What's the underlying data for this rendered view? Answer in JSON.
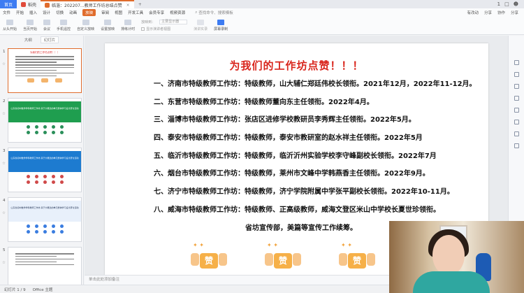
{
  "titlebar": {
    "tabs": [
      {
        "label": "首页",
        "kind": "home"
      },
      {
        "label": "稻壳",
        "kind": "doc"
      },
      {
        "label": "临淄：202207...教师工作坊总结点赞",
        "kind": "ppt"
      }
    ],
    "new_tab": "+",
    "right_items": [
      "1",
      "□",
      "☻"
    ]
  },
  "menubar": {
    "items": [
      "文件",
      "开始",
      "插入",
      "设计",
      "切换",
      "动画",
      "放映",
      "审阅",
      "视图",
      "开发工具",
      "会员专享",
      "视频资源"
    ],
    "active_index": 6,
    "search_placeholder": "查找命令、搜索模板",
    "right": [
      "有改动",
      "分享",
      "协作",
      "分享"
    ]
  },
  "ribbon": {
    "buttons": [
      {
        "label": "从头开始",
        "enabled": true
      },
      {
        "label": "当页开始",
        "enabled": true
      },
      {
        "label": "会议",
        "enabled": true
      },
      {
        "label": "手机遥控",
        "enabled": true
      },
      {
        "label": "自定义放映",
        "enabled": true
      },
      {
        "label": "设置放映",
        "enabled": true
      },
      {
        "label": "排练计时",
        "enabled": true
      }
    ],
    "group": {
      "row1_label": "放映到：",
      "row1_value": "主要显示器",
      "row2_label": "显示演讲者视图"
    },
    "buttons2": [
      {
        "label": "演讲实录",
        "enabled": false
      },
      {
        "label": "屏幕录制",
        "enabled": true
      }
    ]
  },
  "leftpanel": {
    "tabs": [
      "大纲",
      "幻灯片"
    ],
    "active_tab": 1,
    "slides": [
      {
        "num": "1",
        "style": "title",
        "caption": "为我们的工作坊点赞！！！"
      },
      {
        "num": "2",
        "style": "green",
        "caption": "山东省初中数学学科教师工作坊 基于大概念的单元整体学习设计研讨活动"
      },
      {
        "num": "3",
        "style": "blue",
        "caption": "山东省初中数学学科教师工作坊 基于大概念的单元整体学习设计研讨活动"
      },
      {
        "num": "4",
        "style": "light",
        "caption": "山东省初中数学学科教师工作坊 基于大概念的单元整体学习设计研讨活动"
      },
      {
        "num": "5",
        "style": "title",
        "caption": ""
      }
    ]
  },
  "slide": {
    "title": "为我们的工作坊点赞！！！",
    "items": [
      {
        "prefix": "一、济南市特级教师工作坊：特级教师，",
        "text": "山大辅仁郑廷伟校长领衔。2021年12月，2022年11-12月。"
      },
      {
        "prefix": "二、东营市特级教师工作坊：特级教师",
        "text": "董向东主任领衔。2022年4月。"
      },
      {
        "prefix": "三、淄博市特级教师工作坊：",
        "text": "张店区进修学校教研员李秀辉主任领衔。2022年5月。"
      },
      {
        "prefix": "四、泰安市特级教师工作坊：特级教师，",
        "text": "泰安市教研室的赵水祥主任领衔。2022年5月"
      },
      {
        "prefix": "五、临沂市特级教师工作坊：特级教师，",
        "text": "临沂沂州实验学校李守峰副校长领衔。2022年7月"
      },
      {
        "prefix": "六、烟台市特级教师工作坊：特级教师，",
        "text": "莱州市文峰中学韩燕香主任领衔。2022年9月。"
      },
      {
        "prefix": "七、济宁市特级教师工作坊：特级教师，",
        "text": "济宁学院附属中学张平副校长领衔。2022年10-11月。"
      },
      {
        "prefix": "八、威海市特级教师工作坊：特级教师、",
        "text": "正高级教师，威海文登区米山中学校长夏世珍领衔。"
      }
    ],
    "footer": "省坊宣传部，美篇等宣传工作续筹。",
    "likes": [
      "赞",
      "赞",
      "赞"
    ]
  },
  "notes": {
    "placeholder": "单击此处添加备注"
  },
  "status": {
    "slide_counter": "幻灯片 1 / 9",
    "theme": "Office 主题"
  },
  "colors": {
    "accent": "#e06c2c",
    "title_red": "#d9251c",
    "home_blue": "#3d7cf2"
  }
}
